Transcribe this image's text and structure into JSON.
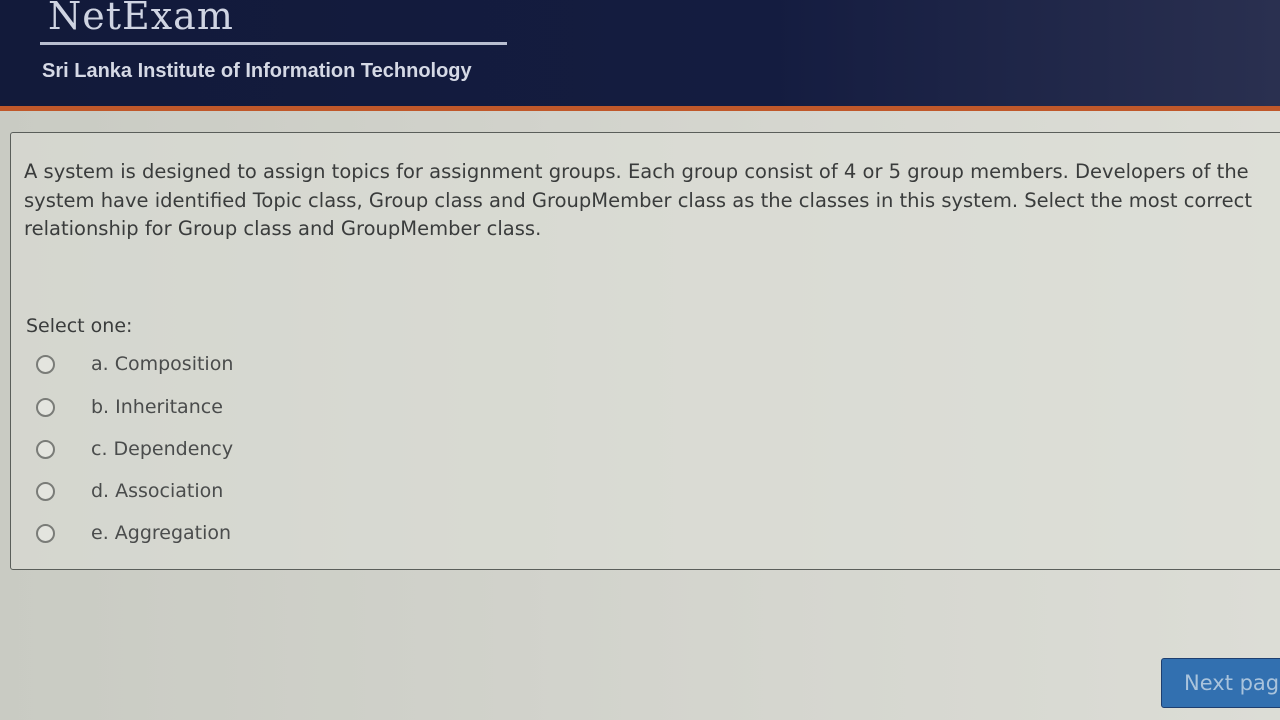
{
  "header": {
    "brand": "NetExam",
    "institute": "Sri Lanka Institute of Information Technology"
  },
  "question": {
    "text": "A system is designed to assign topics for assignment groups. Each group consist of 4 or 5 group members. Developers of the system have identified Topic class, Group class and GroupMember class as the classes in this system. Select the most correct relationship for Group class and GroupMember class.",
    "prompt": "Select one:",
    "options": [
      {
        "label": "a. Composition",
        "selected": false
      },
      {
        "label": "b. Inheritance",
        "selected": false
      },
      {
        "label": "c. Dependency",
        "selected": false
      },
      {
        "label": "d. Association",
        "selected": false
      },
      {
        "label": "e. Aggregation",
        "selected": false
      }
    ]
  },
  "nav": {
    "next_label": "Next page"
  },
  "colors": {
    "header": "#141c40",
    "accent_stripe": "#c0582a",
    "button": "#3270b0"
  }
}
